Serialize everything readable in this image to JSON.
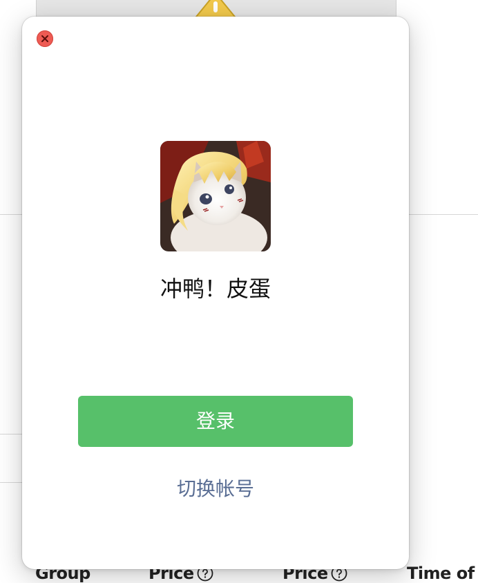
{
  "background": {
    "table_headers": [
      "Group",
      "Price",
      "Price",
      "Time of"
    ],
    "icons": [
      "warning-icon",
      "help-icon"
    ]
  },
  "dialog": {
    "close_icon": "close-icon",
    "username": "冲鸭！皮蛋",
    "login_label": "登录",
    "switch_account_label": "切换帐号"
  },
  "colors": {
    "login_button": "#57c06a",
    "switch_link": "#5a6e94",
    "close_button": "#ee5b54"
  }
}
